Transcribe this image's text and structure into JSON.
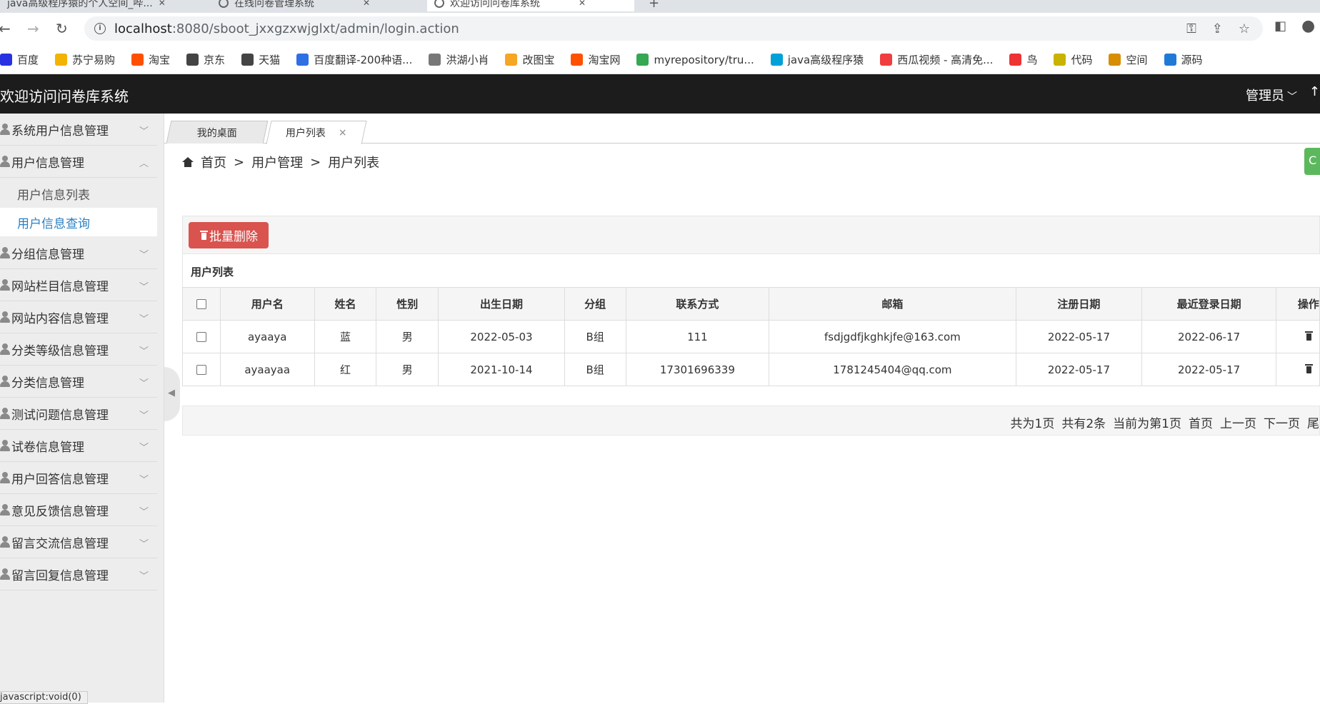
{
  "browser": {
    "tabs": [
      {
        "title": "java高级程序猿的个人空间_哔..."
      },
      {
        "title": "在线问卷管理系统"
      },
      {
        "title": "欢迎访问问卷库系统"
      }
    ],
    "url_host": "localhost",
    "url_path": ":8080/sboot_jxxgzxwjglxt/admin/login.action",
    "bookmarks": [
      {
        "label": "百度",
        "color": "#2932e1"
      },
      {
        "label": "苏宁易购",
        "color": "#f2b400"
      },
      {
        "label": "淘宝",
        "color": "#ff5000"
      },
      {
        "label": "京东",
        "color": "#444444"
      },
      {
        "label": "天猫",
        "color": "#444444"
      },
      {
        "label": "百度翻译-200种语...",
        "color": "#2f6fe4"
      },
      {
        "label": "洪湖小肖",
        "color": "#777777"
      },
      {
        "label": "改图宝",
        "color": "#f5a623"
      },
      {
        "label": "淘宝网",
        "color": "#ff5000"
      },
      {
        "label": "myrepository/tru...",
        "color": "#34a853"
      },
      {
        "label": "java高级程序猿",
        "color": "#00a1d6"
      },
      {
        "label": "西瓜视频 - 高清免...",
        "color": "#f03d3d"
      },
      {
        "label": "鸟",
        "color": "#e33"
      },
      {
        "label": "代码",
        "color": "#c9b200"
      },
      {
        "label": "空间",
        "color": "#d88c00"
      },
      {
        "label": "源码",
        "color": "#1f7ad6"
      }
    ],
    "status_url": "javascript:void(0)"
  },
  "header": {
    "title": "欢迎访问问卷库系统",
    "admin_label": "管理员"
  },
  "sidebar": {
    "items": [
      {
        "label": "系统用户信息管理",
        "expanded": false
      },
      {
        "label": "用户信息管理",
        "expanded": true
      },
      {
        "label": "分组信息管理",
        "expanded": false
      },
      {
        "label": "网站栏目信息管理",
        "expanded": false
      },
      {
        "label": "网站内容信息管理",
        "expanded": false
      },
      {
        "label": "分类等级信息管理",
        "expanded": false
      },
      {
        "label": "分类信息管理",
        "expanded": false
      },
      {
        "label": "测试问题信息管理",
        "expanded": false
      },
      {
        "label": "试卷信息管理",
        "expanded": false
      },
      {
        "label": "用户回答信息管理",
        "expanded": false
      },
      {
        "label": "意见反馈信息管理",
        "expanded": false
      },
      {
        "label": "留言交流信息管理",
        "expanded": false
      },
      {
        "label": "留言回复信息管理",
        "expanded": false
      }
    ],
    "subitems": [
      {
        "label": "用户信息列表"
      },
      {
        "label": "用户信息查询"
      }
    ]
  },
  "content_tabs": [
    {
      "label": "我的桌面"
    },
    {
      "label": "用户列表",
      "close": "×"
    }
  ],
  "breadcrumb": {
    "home": "首页",
    "sep": ">",
    "level1": "用户管理",
    "level2": "用户列表"
  },
  "toolbar": {
    "batch_delete": "批量删除"
  },
  "table": {
    "title": "用户列表",
    "columns": [
      "用户名",
      "姓名",
      "性别",
      "出生日期",
      "分组",
      "联系方式",
      "邮箱",
      "注册日期",
      "最近登录日期",
      "操作"
    ],
    "rows": [
      {
        "username": "ayaaya",
        "name": "蓝",
        "gender": "男",
        "birth": "2022-05-03",
        "group": "B组",
        "contact": "111",
        "email": "fsdjgdfjkghkjfe@163.com",
        "reg_date": "2022-05-17",
        "last_login": "2022-06-17"
      },
      {
        "username": "ayaayaa",
        "name": "红",
        "gender": "男",
        "birth": "2021-10-14",
        "group": "B组",
        "contact": "17301696339",
        "email": "1781245404@qq.com",
        "reg_date": "2022-05-17",
        "last_login": "2022-05-17"
      }
    ]
  },
  "pager": {
    "total_pages": "共为1页",
    "total_items": "共有2条",
    "current": "当前为第1页",
    "first": "首页",
    "prev": "上一页",
    "next": "下一页",
    "last": "尾"
  },
  "colors": {
    "header_bg": "#1c1c1c",
    "danger": "#d9534f",
    "link_active": "#2a7fc2",
    "success": "#5cb85c"
  }
}
